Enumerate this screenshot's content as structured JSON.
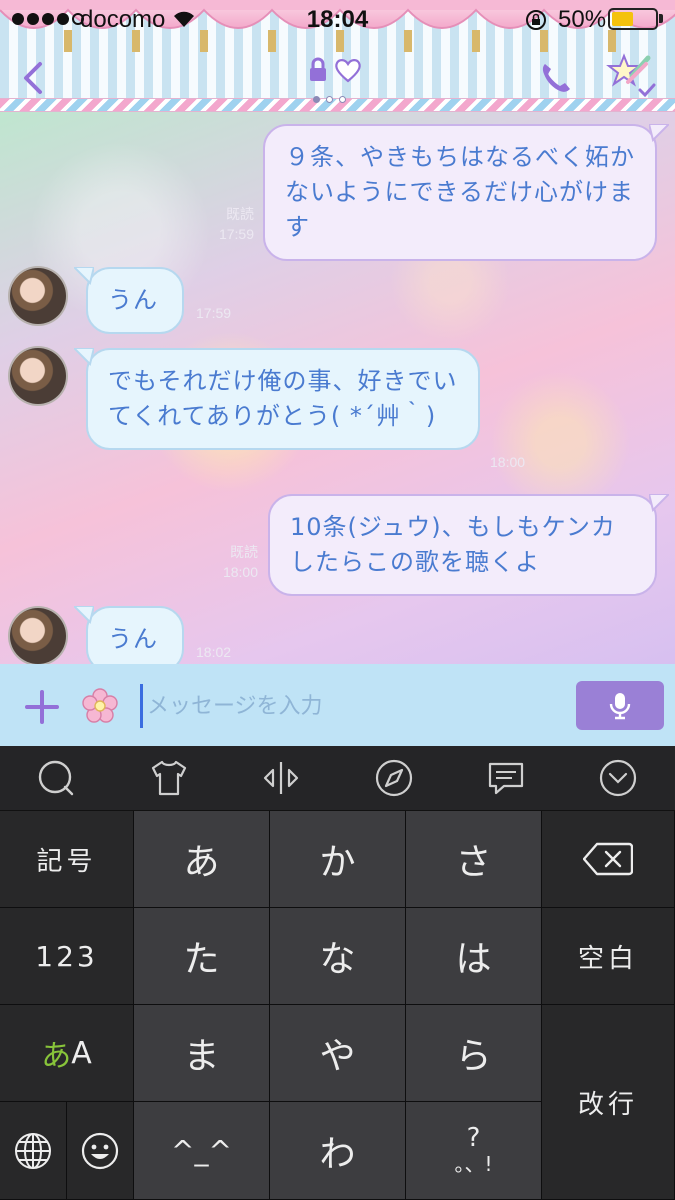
{
  "status_bar": {
    "carrier": "docomo",
    "time": "18:04",
    "battery_pct": "50%",
    "battery_level": 0.5
  },
  "nav": {
    "back_icon": "chevron-left-icon",
    "title_icons": [
      "lock-icon",
      "heart-icon"
    ],
    "phone_icon": "phone-icon",
    "menu_icon": "star-wand-menu-icon",
    "page_dots": 3,
    "active_dot": 0
  },
  "chat": {
    "messages": [
      {
        "dir": "out",
        "text": "９条、やきもちはなるべく妬かないようにできるだけ心がけます",
        "read": "既読",
        "time": "17:59"
      },
      {
        "dir": "in",
        "text": "うん",
        "time": "17:59"
      },
      {
        "dir": "in",
        "text": "でもそれだけ俺の事、好きでいてくれてありがとう( *´艸｀)",
        "time": "18:00"
      },
      {
        "dir": "out",
        "text": "10条(ジュウ)、もしもケンカしたらこの歌を聴くよ",
        "read": "既読",
        "time": "18:00"
      },
      {
        "dir": "in",
        "text": "うん",
        "time": "18:02"
      }
    ]
  },
  "input": {
    "placeholder": "メッセージを入力",
    "plus_icon": "plus-icon",
    "sticker_icon": "flower-icon",
    "mic_icon": "microphone-icon"
  },
  "keyboard_toolbar": [
    "search-bubble-icon",
    "tshirt-icon",
    "cursor-move-icon",
    "compass-icon",
    "chat-bubble-icon",
    "chevron-down-circle-icon"
  ],
  "keyboard": {
    "symbols": "記号",
    "numbers": "123",
    "kana_a": "あ",
    "kana_A": "A",
    "row1": [
      "あ",
      "か",
      "さ"
    ],
    "row2": [
      "た",
      "な",
      "は"
    ],
    "row3": [
      "ま",
      "や",
      "ら"
    ],
    "emoticon": "^_^",
    "wa": "わ",
    "punct_top": "?",
    "punct_bottom": "。、!",
    "space": "空白",
    "return": "改行",
    "delete_icon": "backspace-icon",
    "globe_icon": "globe-icon",
    "emoji_icon": "smiley-icon"
  },
  "colors": {
    "bubble_text": "#4a7bd0",
    "out_bubble": "#f3ecfb",
    "in_bubble": "#e6f5fd",
    "input_bar": "#bfe3f6",
    "mic_button": "#9a80d6",
    "accent_purple": "#9370d8"
  }
}
